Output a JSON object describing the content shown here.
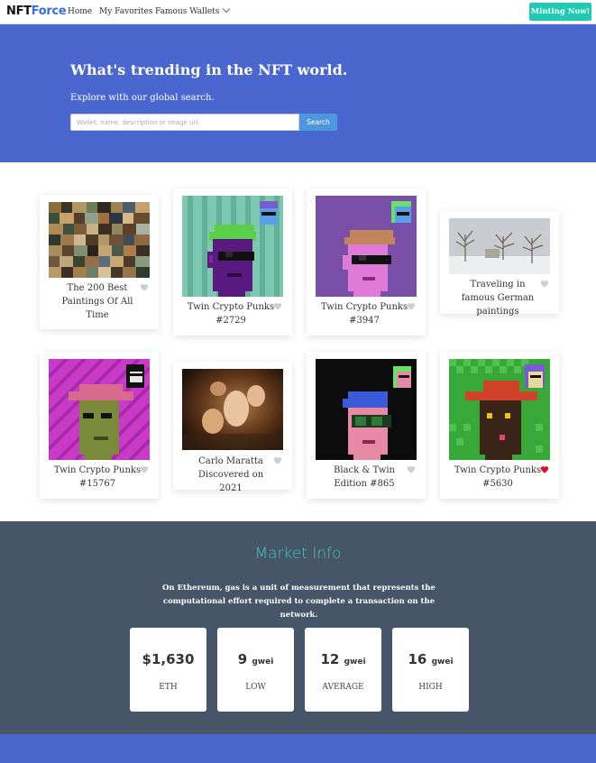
{
  "navbar": {
    "brand_part1": "NFT",
    "brand_part2": "Force",
    "links": [
      "Home",
      "My Favorites",
      "Famous Wallets"
    ],
    "mint_label": "Minting Now!"
  },
  "hero": {
    "title": "What's trending in the NFT world.",
    "subtitle": "Explore with our global search.",
    "search_placeholder": "Wallet, name, description or image url.",
    "search_button": "Search"
  },
  "gallery": {
    "cards": [
      {
        "title": "The 200 Best Paintings Of All Time",
        "favorited": false,
        "image": "painting-collage"
      },
      {
        "title": "Twin Crypto Punks #2729",
        "favorited": false,
        "image": "punk-teal"
      },
      {
        "title": "Twin Crypto Punks #3947",
        "favorited": false,
        "image": "punk-purple"
      },
      {
        "title": "Traveling in famous German paintings",
        "favorited": false,
        "image": "winter-landscape"
      },
      {
        "title": "Twin Crypto Punks #15767",
        "favorited": false,
        "image": "punk-magenta"
      },
      {
        "title": "Carlo Maratta Discovered on 2021",
        "favorited": false,
        "image": "baroque-painting"
      },
      {
        "title": "Black & Twin Edition #865",
        "favorited": false,
        "image": "punk-black"
      },
      {
        "title": "Twin Crypto Punks #5630",
        "favorited": true,
        "image": "punk-green"
      }
    ]
  },
  "market": {
    "title": "Market Info",
    "description": "On Ethereum, gas is a unit of measurement that represents the computational effort required to complete a transaction on the network.",
    "stats": [
      {
        "value": "$1,630",
        "unit": "",
        "label": "ETH"
      },
      {
        "value": "9",
        "unit": "gwei",
        "label": "LOW"
      },
      {
        "value": "12",
        "unit": "gwei",
        "label": "AVERAGE"
      },
      {
        "value": "16",
        "unit": "gwei",
        "label": "HIGH"
      }
    ]
  },
  "colors": {
    "brand_blue": "#4a66cf",
    "mint_teal": "#1ecbb3",
    "market_bg": "#475569",
    "heart_active": "#e0102a",
    "heart_inactive": "#cfcfcf"
  }
}
